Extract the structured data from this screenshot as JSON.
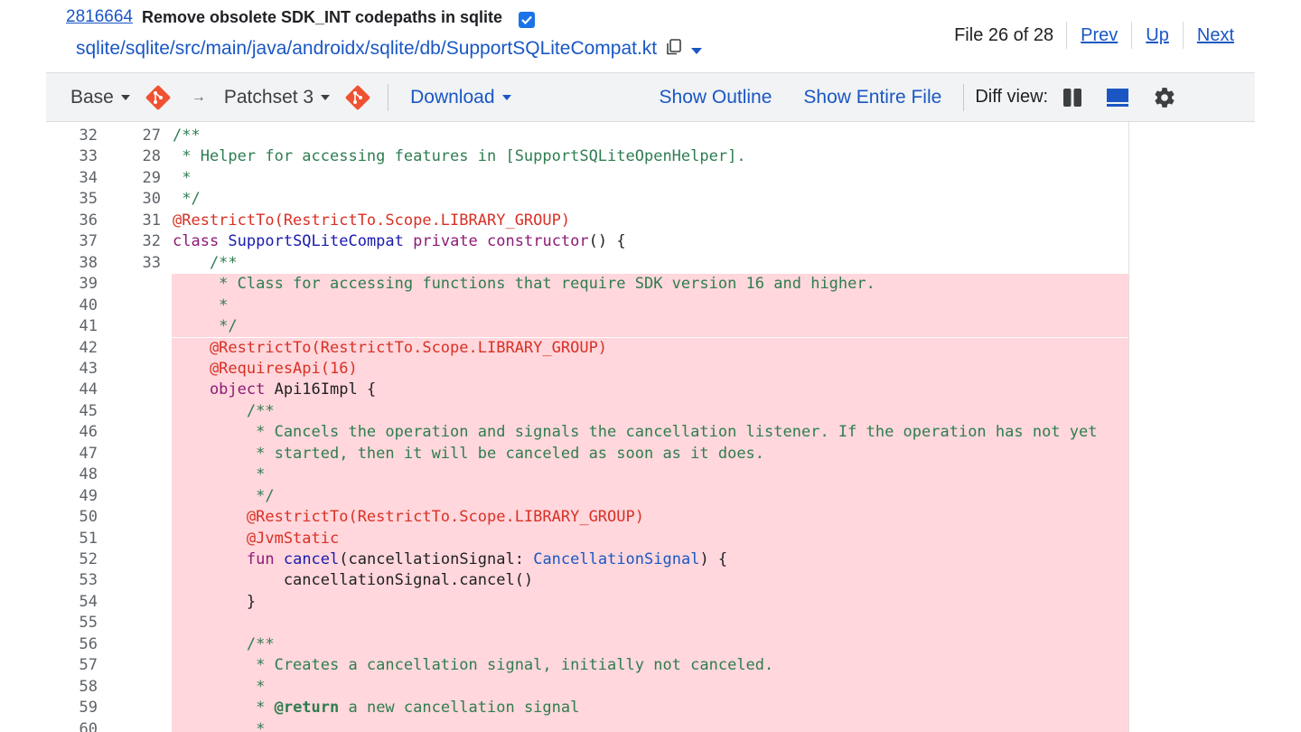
{
  "header": {
    "change_number": "2816664",
    "change_title": "Remove obsolete SDK_INT codepaths in sqlite",
    "file_path": "sqlite/sqlite/src/main/java/androidx/sqlite/db/SupportSQLiteCompat.kt",
    "file_count": "File 26 of 28",
    "prev_label": "Prev",
    "up_label": "Up",
    "next_label": "Next"
  },
  "toolbar": {
    "base_label": "Base",
    "arrow": "→",
    "patchset_label": "Patchset 3",
    "download_label": "Download",
    "show_outline_label": "Show Outline",
    "show_entire_file_label": "Show Entire File",
    "diff_view_label": "Diff view:"
  },
  "colors": {
    "link": "#1a57c4",
    "removed_bg": "#ffd7dc",
    "git_orange": "#f05133",
    "checkbox_blue": "#1a73e8"
  },
  "diff": {
    "rows": [
      {
        "left": "32",
        "right": "27",
        "removed": false,
        "tokens": [
          [
            "c",
            "/**"
          ]
        ]
      },
      {
        "left": "33",
        "right": "28",
        "removed": false,
        "tokens": [
          [
            "c",
            " * Helper for accessing features in [SupportSQLiteOpenHelper]."
          ]
        ]
      },
      {
        "left": "34",
        "right": "29",
        "removed": false,
        "tokens": [
          [
            "c",
            " *"
          ]
        ]
      },
      {
        "left": "35",
        "right": "30",
        "removed": false,
        "tokens": [
          [
            "c",
            " */"
          ]
        ]
      },
      {
        "left": "36",
        "right": "31",
        "removed": false,
        "tokens": [
          [
            "a",
            "@RestrictTo(RestrictTo.Scope.LIBRARY_GROUP)"
          ]
        ]
      },
      {
        "left": "37",
        "right": "32",
        "removed": false,
        "tokens": [
          [
            "k",
            "class "
          ],
          [
            "f",
            "SupportSQLiteCompat"
          ],
          [
            "p",
            " "
          ],
          [
            "k",
            "private"
          ],
          [
            "p",
            " "
          ],
          [
            "k",
            "constructor"
          ],
          [
            "p",
            "() {"
          ]
        ]
      },
      {
        "left": "38",
        "right": "33",
        "removed": false,
        "tokens": [
          [
            "c",
            "    /**"
          ]
        ]
      },
      {
        "left": "39",
        "right": "",
        "removed": true,
        "tokens": [
          [
            "c",
            "     * Class for accessing functions that require SDK version 16 and higher."
          ]
        ]
      },
      {
        "left": "40",
        "right": "",
        "removed": true,
        "tokens": [
          [
            "c",
            "     *"
          ]
        ]
      },
      {
        "left": "41",
        "right": "",
        "removed": true,
        "tokens": [
          [
            "c",
            "     */"
          ]
        ]
      },
      {
        "left": "42",
        "right": "",
        "removed": true,
        "tokens": [
          [
            "a",
            "    @RestrictTo(RestrictTo.Scope.LIBRARY_GROUP)"
          ]
        ]
      },
      {
        "left": "43",
        "right": "",
        "removed": true,
        "tokens": [
          [
            "a",
            "    @RequiresApi(16)"
          ]
        ]
      },
      {
        "left": "44",
        "right": "",
        "removed": true,
        "tokens": [
          [
            "k",
            "    object"
          ],
          [
            "p",
            " Api16Impl {"
          ]
        ]
      },
      {
        "left": "45",
        "right": "",
        "removed": true,
        "tokens": [
          [
            "c",
            "        /**"
          ]
        ]
      },
      {
        "left": "46",
        "right": "",
        "removed": true,
        "tokens": [
          [
            "c",
            "         * Cancels the operation and signals the cancellation listener. If the operation has not yet"
          ]
        ]
      },
      {
        "left": "47",
        "right": "",
        "removed": true,
        "tokens": [
          [
            "c",
            "         * started, then it will be canceled as soon as it does."
          ]
        ]
      },
      {
        "left": "48",
        "right": "",
        "removed": true,
        "tokens": [
          [
            "c",
            "         *"
          ]
        ]
      },
      {
        "left": "49",
        "right": "",
        "removed": true,
        "tokens": [
          [
            "c",
            "         */"
          ]
        ]
      },
      {
        "left": "50",
        "right": "",
        "removed": true,
        "tokens": [
          [
            "a",
            "        @RestrictTo(RestrictTo.Scope.LIBRARY_GROUP)"
          ]
        ]
      },
      {
        "left": "51",
        "right": "",
        "removed": true,
        "tokens": [
          [
            "a",
            "        @JvmStatic"
          ]
        ]
      },
      {
        "left": "52",
        "right": "",
        "removed": true,
        "tokens": [
          [
            "k",
            "        fun"
          ],
          [
            "p",
            " "
          ],
          [
            "f",
            "cancel"
          ],
          [
            "p",
            "(cancellationSignal: "
          ],
          [
            "t",
            "CancellationSignal"
          ],
          [
            "p",
            ") {"
          ]
        ]
      },
      {
        "left": "53",
        "right": "",
        "removed": true,
        "tokens": [
          [
            "p",
            "            cancellationSignal.cancel()"
          ]
        ]
      },
      {
        "left": "54",
        "right": "",
        "removed": true,
        "tokens": [
          [
            "p",
            "        }"
          ]
        ]
      },
      {
        "left": "55",
        "right": "",
        "removed": true,
        "tokens": [
          [
            "p",
            ""
          ]
        ]
      },
      {
        "left": "56",
        "right": "",
        "removed": true,
        "tokens": [
          [
            "c",
            "        /**"
          ]
        ]
      },
      {
        "left": "57",
        "right": "",
        "removed": true,
        "tokens": [
          [
            "c",
            "         * Creates a cancellation signal, initially not canceled."
          ]
        ]
      },
      {
        "left": "58",
        "right": "",
        "removed": true,
        "tokens": [
          [
            "c",
            "         *"
          ]
        ]
      },
      {
        "left": "59",
        "right": "",
        "removed": true,
        "tokens": [
          [
            "c",
            "         * "
          ],
          [
            "b",
            "@return"
          ],
          [
            "c",
            " a new cancellation signal"
          ]
        ]
      },
      {
        "left": "60",
        "right": "",
        "removed": true,
        "tokens": [
          [
            "c",
            "         *"
          ]
        ]
      }
    ]
  }
}
